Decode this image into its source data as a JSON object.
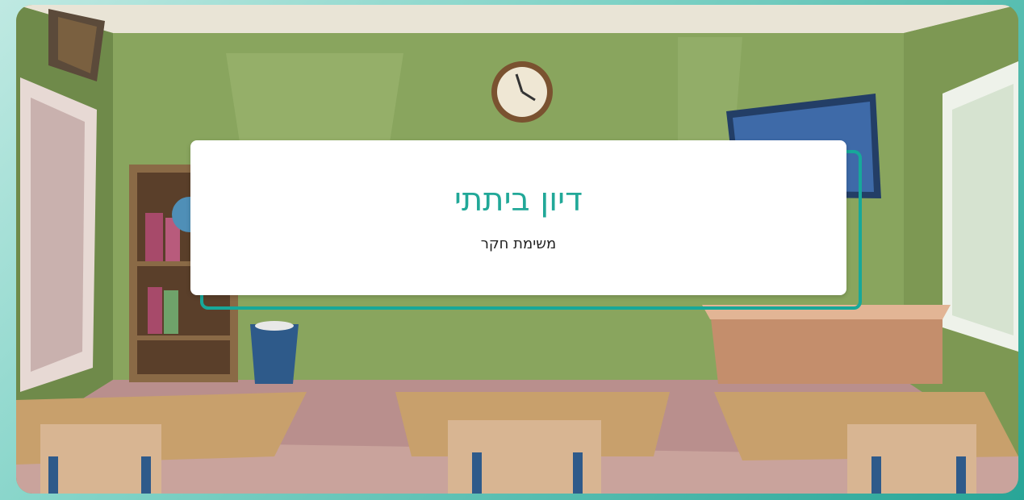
{
  "card": {
    "title": "דיון ביתתי",
    "subtitle": "משימת חקר"
  },
  "colors": {
    "accent": "#21a898",
    "frame": "#2a9e8f",
    "wall": "#7f9a55"
  },
  "background": {
    "scene": "classroom-illustration"
  }
}
